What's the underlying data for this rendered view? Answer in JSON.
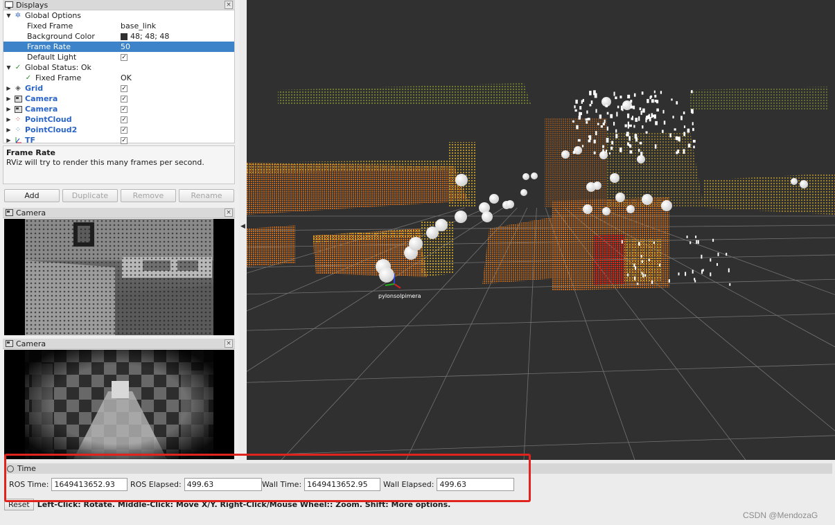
{
  "displays_panel": {
    "title": "Displays",
    "rows": [
      {
        "name": "Global Options",
        "value": ""
      },
      {
        "name": "Fixed Frame",
        "value": "base_link"
      },
      {
        "name": "Background Color",
        "value": "48; 48; 48"
      },
      {
        "name": "Frame Rate",
        "value": "50"
      },
      {
        "name": "Default Light",
        "value": "✓"
      },
      {
        "name": "Global Status: Ok",
        "value": ""
      },
      {
        "name": "Fixed Frame",
        "value": "OK"
      },
      {
        "name": "Grid",
        "value": "✓"
      },
      {
        "name": "Camera",
        "value": "✓"
      },
      {
        "name": "Camera",
        "value": "✓"
      },
      {
        "name": "PointCloud",
        "value": "✓"
      },
      {
        "name": "PointCloud2",
        "value": "✓"
      },
      {
        "name": "TF",
        "value": "✓"
      }
    ],
    "description": {
      "title": "Frame Rate",
      "body": "RViz will try to render this many frames per second."
    },
    "buttons": [
      "Add",
      "Duplicate",
      "Remove",
      "Rename"
    ]
  },
  "camera_panels": [
    {
      "title": "Camera"
    },
    {
      "title": "Camera"
    }
  ],
  "view": {
    "frame_label": "pylonsolpimera",
    "background_color": "#303030"
  },
  "time_panel": {
    "title": "Time",
    "ros_time_label": "ROS Time:",
    "ros_time": "1649413652.93",
    "ros_elapsed_label": "ROS Elapsed:",
    "ros_elapsed": "499.63",
    "wall_time_label": "Wall Time:",
    "wall_time": "1649413652.95",
    "wall_elapsed_label": "Wall Elapsed:",
    "wall_elapsed": "499.63"
  },
  "status_bar": {
    "reset_label": "Reset",
    "help_text": "Left-Click: Rotate. Middle-Click: Move X/Y. Right-Click/Mouse Wheel:: Zoom. Shift: More options."
  },
  "watermark": "CSDN @MendozaG",
  "colors": {
    "selection": "#3d83c9",
    "highlight_box": "#e0231c",
    "display_name_blue": "#2a64c8"
  }
}
